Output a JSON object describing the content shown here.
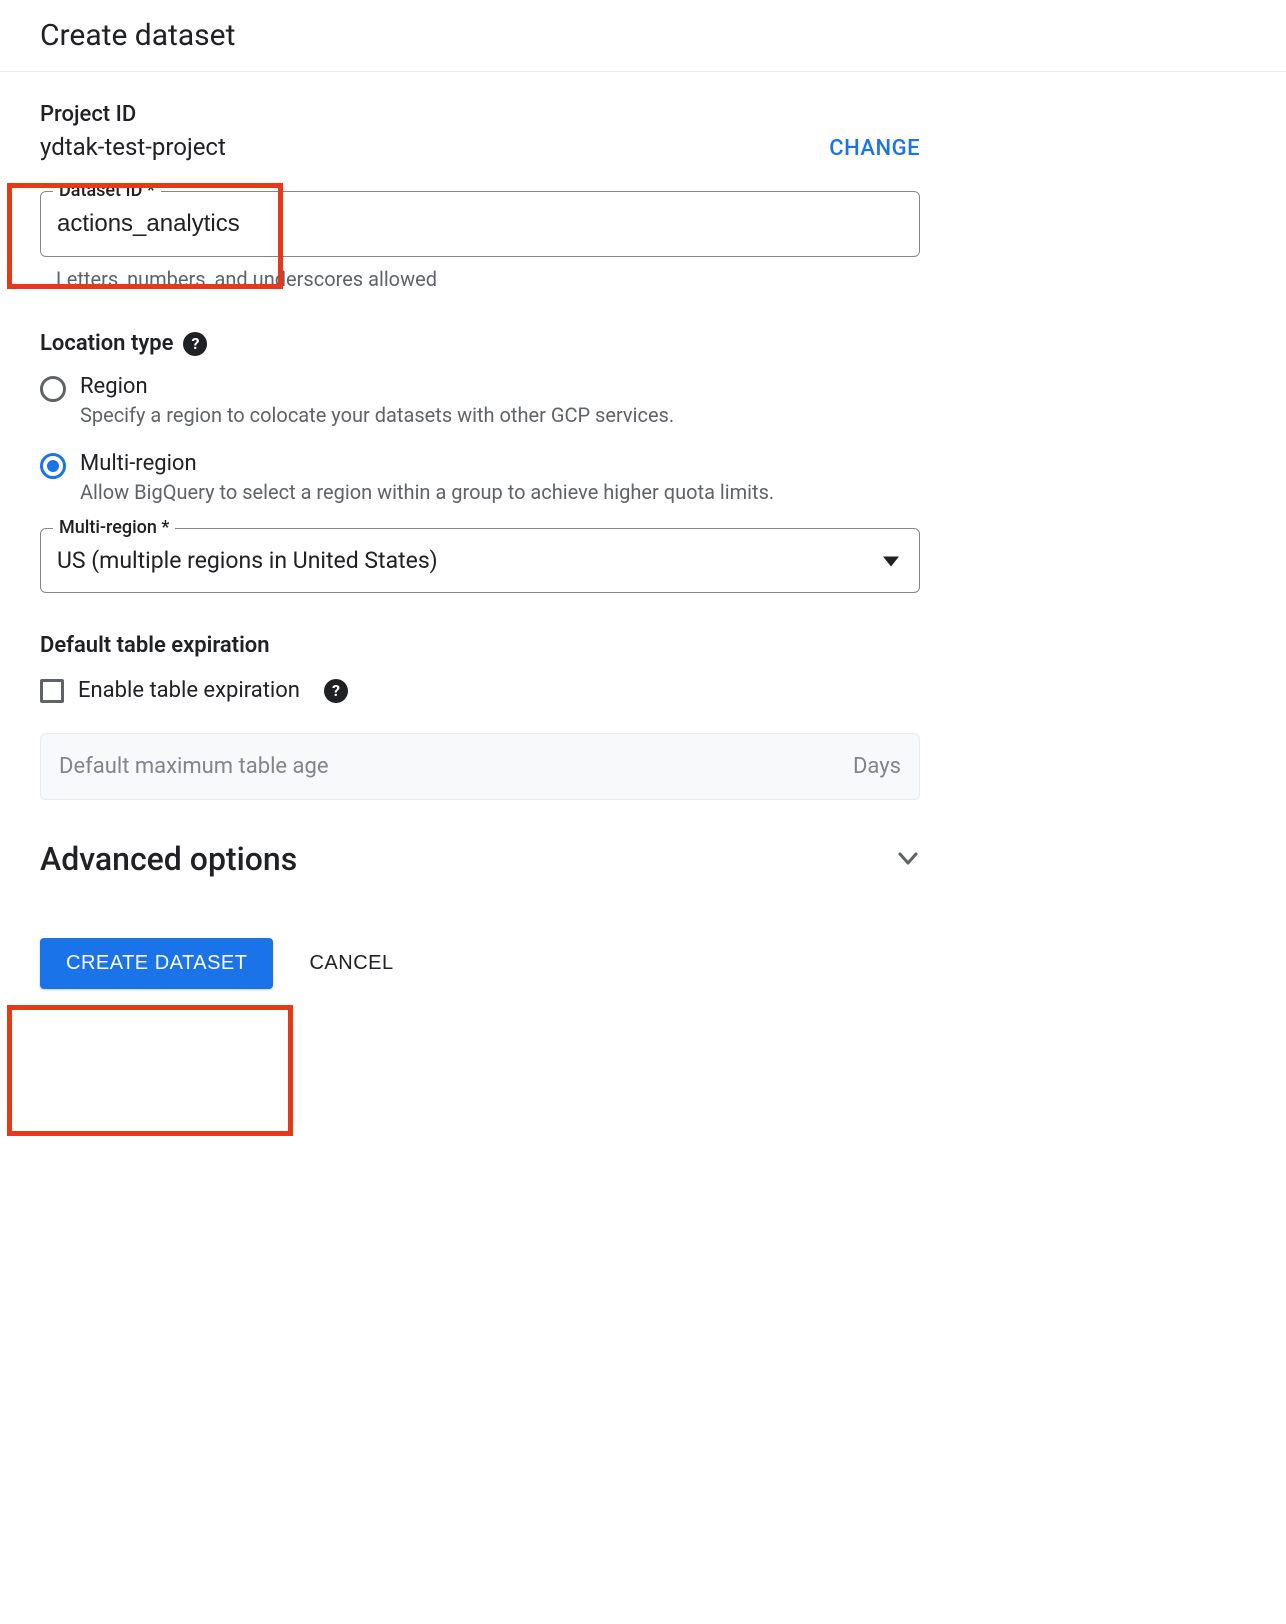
{
  "header": {
    "title": "Create dataset"
  },
  "project": {
    "label": "Project ID",
    "value": "ydtak-test-project",
    "change_label": "CHANGE"
  },
  "dataset_id": {
    "label": "Dataset ID *",
    "value": "actions_analytics",
    "helper": "Letters, numbers, and underscores allowed"
  },
  "location_type": {
    "label": "Location type",
    "options": [
      {
        "title": "Region",
        "desc": "Specify a region to colocate your datasets with other GCP services.",
        "selected": false
      },
      {
        "title": "Multi-region",
        "desc": "Allow BigQuery to select a region within a group to achieve higher quota limits.",
        "selected": true
      }
    ]
  },
  "multi_region": {
    "label": "Multi-region *",
    "value": "US (multiple regions in United States)"
  },
  "expiration": {
    "heading": "Default table expiration",
    "checkbox_label": "Enable table expiration",
    "placeholder": "Default maximum table age",
    "unit": "Days"
  },
  "advanced": {
    "label": "Advanced options"
  },
  "buttons": {
    "create": "CREATE DATASET",
    "cancel": "CANCEL"
  }
}
